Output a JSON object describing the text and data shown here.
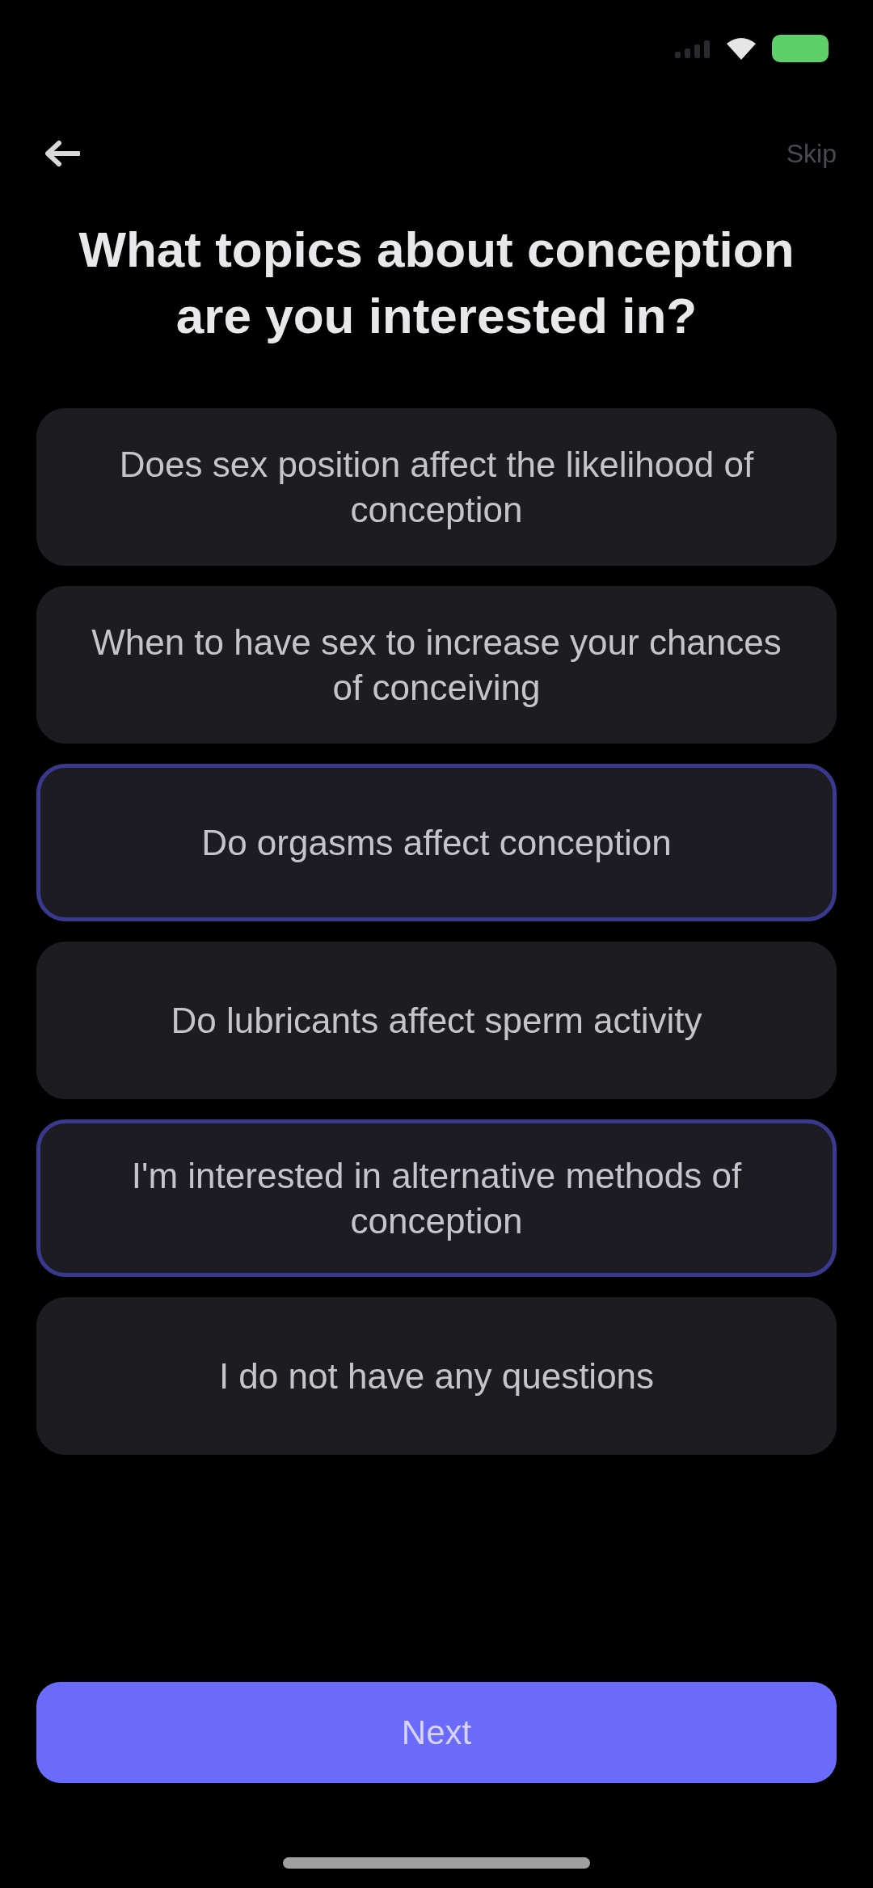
{
  "nav": {
    "skip": "Skip"
  },
  "title": "What topics about conception are you interested in?",
  "options": [
    {
      "label": "Does sex position affect the likelihood of conception",
      "selected": false
    },
    {
      "label": "When to have sex to increase your chances of conceiving",
      "selected": false
    },
    {
      "label": "Do orgasms affect conception",
      "selected": true
    },
    {
      "label": "Do lubricants affect sperm activity",
      "selected": false
    },
    {
      "label": "I'm interested in alternative methods of conception",
      "selected": true
    },
    {
      "label": "I do not have any questions",
      "selected": false
    }
  ],
  "next_button": {
    "label": "Next"
  }
}
